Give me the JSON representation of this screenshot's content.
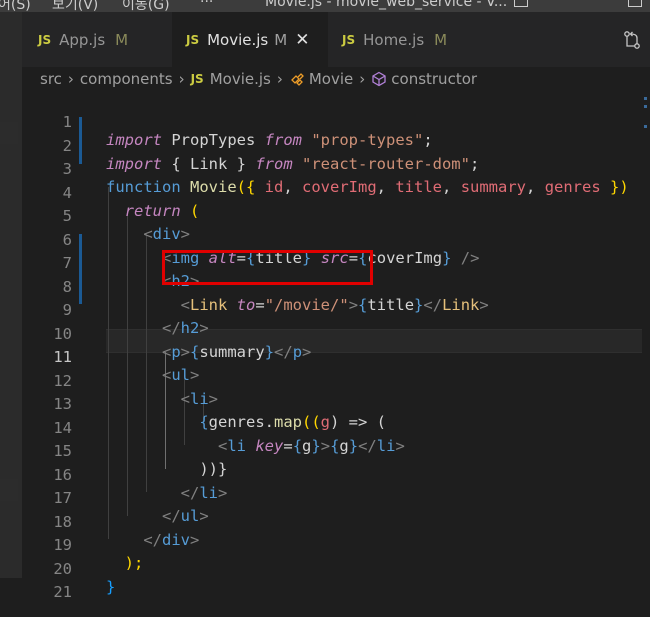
{
  "titlebar": {
    "menu_items": [
      "어(S)",
      "보기(V)",
      "이동(G)",
      "···"
    ],
    "window_title": "Movie.js - movie_web_service - V..."
  },
  "tabs": [
    {
      "icon": "JS",
      "label": "App.js",
      "status": "M",
      "active": false
    },
    {
      "icon": "JS",
      "label": "Movie.js",
      "status": "M",
      "active": true
    },
    {
      "icon": "JS",
      "label": "Home.js",
      "status": "M",
      "active": false
    }
  ],
  "breadcrumb": {
    "items": [
      "src",
      "components",
      "Movie.js",
      "Movie",
      "constructor"
    ],
    "file_icon": "JS",
    "separator": "›"
  },
  "editor": {
    "current_line": 11,
    "lines": [
      {
        "n": "1"
      },
      {
        "n": "2"
      },
      {
        "n": "3"
      },
      {
        "n": "4"
      },
      {
        "n": "5"
      },
      {
        "n": "6"
      },
      {
        "n": "7"
      },
      {
        "n": "8"
      },
      {
        "n": "9"
      },
      {
        "n": "10"
      },
      {
        "n": "11"
      },
      {
        "n": "12"
      },
      {
        "n": "13"
      },
      {
        "n": "14"
      },
      {
        "n": "15"
      },
      {
        "n": "16"
      },
      {
        "n": "17"
      },
      {
        "n": "18"
      },
      {
        "n": "19"
      },
      {
        "n": "20"
      },
      {
        "n": "21"
      }
    ],
    "tokens": {
      "l1": [
        "import",
        " PropTypes ",
        "from",
        " ",
        "\"prop-types\"",
        ";"
      ],
      "l2": [
        "import",
        " { Link } ",
        "from",
        " ",
        "\"react-router-dom\"",
        ";"
      ],
      "l3": [
        "function",
        " ",
        "Movie",
        "({ ",
        "id",
        ", ",
        "coverImg",
        ", ",
        "title",
        ", ",
        "summary",
        ", ",
        "genres",
        " })"
      ],
      "l4": [
        "  ",
        "return",
        " ("
      ],
      "l5": [
        "    <",
        "div",
        ">"
      ],
      "l6": [
        "      <",
        "img",
        " ",
        "alt",
        "=",
        "{",
        "title",
        "}",
        " ",
        "src",
        "=",
        "{",
        "coverImg",
        "}",
        " />"
      ],
      "l7": [
        "      <",
        "h2",
        ">"
      ],
      "l8": [
        "        <",
        "Link",
        " ",
        "to",
        "=",
        "\"/movie/\"",
        ">",
        "{",
        "title",
        "}",
        "</",
        "Link",
        ">"
      ],
      "l9": [
        "      </",
        "h2",
        ">"
      ],
      "l10": [
        "      <",
        "p",
        ">",
        "{",
        "summary",
        "}",
        "</",
        "p",
        ">"
      ],
      "l11": [
        "      <",
        "ul",
        ">"
      ],
      "l12": [
        "        <",
        "li",
        ">"
      ],
      "l13": [
        "          {",
        "genres",
        ".",
        "map",
        "((",
        "g",
        ") => ("
      ],
      "l14": [
        "            <",
        "li",
        " ",
        "key",
        "=",
        "{",
        "g",
        "}",
        ">",
        "{",
        "g",
        "}",
        "</",
        "li",
        ">"
      ],
      "l15": [
        "          ))}"
      ],
      "l16": [
        "        </",
        "li",
        ">"
      ],
      "l17": [
        "      </",
        "ul",
        ">"
      ],
      "l18": [
        "    </",
        "div",
        ">"
      ],
      "l19": [
        "  );"
      ],
      "l20": [
        "}"
      ]
    }
  },
  "colors": {
    "highlight_box": "#e00000",
    "gutter_modified": "#1b5a94",
    "js_icon": "#cbcb41"
  },
  "icons": {
    "source_control": "source-control-icon",
    "layout": "layout-icon",
    "close": "close-icon",
    "class_symbol": "class-icon",
    "method_symbol": "method-icon"
  }
}
